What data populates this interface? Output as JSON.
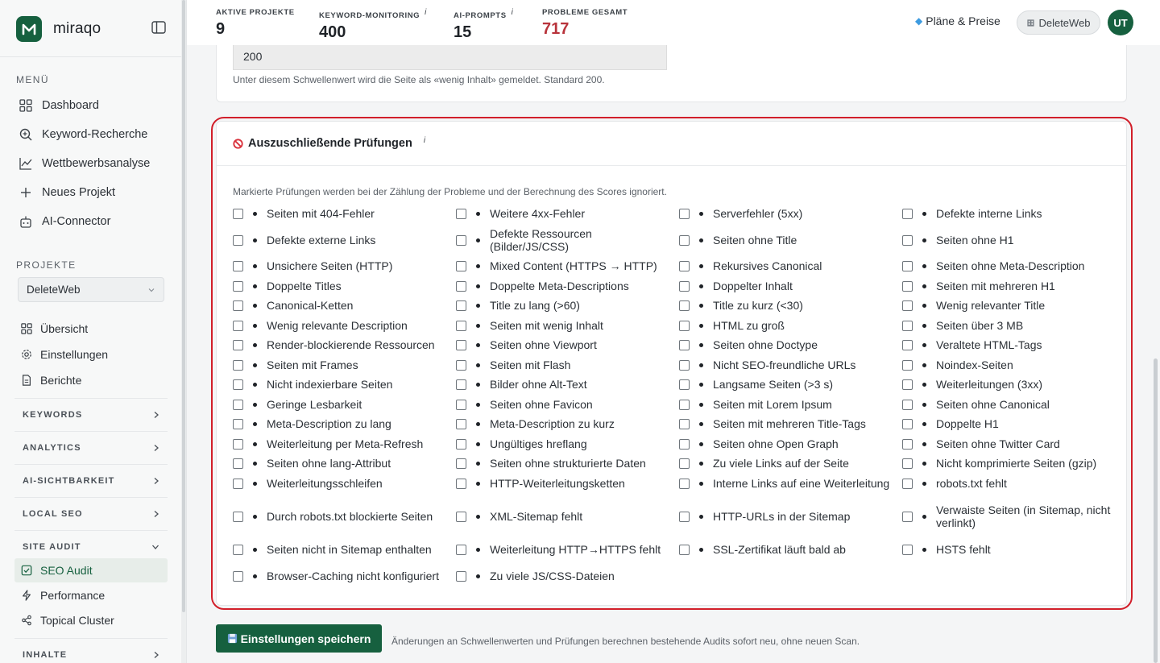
{
  "app": {
    "name": "miraqo"
  },
  "sidebar": {
    "menu_heading": "MENÜ",
    "menu": [
      {
        "label": "Dashboard",
        "icon": "grid-icon"
      },
      {
        "label": "Keyword-Recherche",
        "icon": "search-icon"
      },
      {
        "label": "Wettbewerbsanalyse",
        "icon": "chart-line-icon"
      },
      {
        "label": "Neues Projekt",
        "icon": "plus-icon"
      },
      {
        "label": "AI-Connector",
        "icon": "robot-icon"
      }
    ],
    "projects_heading": "PROJEKTE",
    "project_selected": "DeleteWeb",
    "project_items": [
      {
        "label": "Übersicht",
        "icon": "grid-icon"
      },
      {
        "label": "Einstellungen",
        "icon": "gear-icon"
      },
      {
        "label": "Berichte",
        "icon": "file-icon"
      }
    ],
    "groups": [
      {
        "label": "KEYWORDS",
        "state": "collapsed"
      },
      {
        "label": "ANALYTICS",
        "state": "collapsed"
      },
      {
        "label": "AI-SICHTBARKEIT",
        "state": "collapsed"
      },
      {
        "label": "LOCAL SEO",
        "state": "collapsed"
      },
      {
        "label": "SITE AUDIT",
        "state": "expanded"
      },
      {
        "label": "INHALTE",
        "state": "collapsed"
      }
    ],
    "site_audit_items": [
      {
        "label": "SEO Audit",
        "icon": "checkbox-icon",
        "active": true
      },
      {
        "label": "Performance",
        "icon": "bolt-icon",
        "active": false
      },
      {
        "label": "Topical Cluster",
        "icon": "share-icon",
        "active": false
      }
    ]
  },
  "topbar": {
    "stats": [
      {
        "label": "AKTIVE PROJEKTE",
        "value": "9",
        "info": ""
      },
      {
        "label": "KEYWORD-MONITORING",
        "value": "400",
        "info": "i"
      },
      {
        "label": "AI-PROMPTS",
        "value": "15",
        "info": "i"
      },
      {
        "label": "PROBLEME GESAMT",
        "value": "717",
        "info": "",
        "color": "#b8333b"
      }
    ],
    "plans_label": "Pläne & Preise",
    "workspace_label": "DeleteWeb",
    "avatar_initials": "UT"
  },
  "threshold": {
    "value": "200",
    "hint": "Unter diesem Schwellenwert wird die Seite als «wenig Inhalt» gemeldet. Standard 200."
  },
  "exclusions": {
    "title": "Auszuschließende Prüfungen",
    "info": "i",
    "description": "Markierte Prüfungen werden bei der Zählung der Probleme und der Berechnung des Scores ignoriert.",
    "checks": [
      "Seiten mit 404-Fehler",
      "Weitere 4xx-Fehler",
      "Serverfehler (5xx)",
      "Defekte interne Links",
      "Defekte externe Links",
      "Defekte Ressourcen (Bilder/JS/CSS)",
      "Seiten ohne Title",
      "Seiten ohne H1",
      "Unsichere Seiten (HTTP)",
      "Mixed Content (HTTPS → HTTP)",
      "Rekursives Canonical",
      "Seiten ohne Meta-Description",
      "Doppelte Titles",
      "Doppelte Meta-Descriptions",
      "Doppelter Inhalt",
      "Seiten mit mehreren H1",
      "Canonical-Ketten",
      "Title zu lang (>60)",
      "Title zu kurz (<30)",
      "Wenig relevanter Title",
      "Wenig relevante Description",
      "Seiten mit wenig Inhalt",
      "HTML zu groß",
      "Seiten über 3 MB",
      "Render-blockierende Ressourcen",
      "Seiten ohne Viewport",
      "Seiten ohne Doctype",
      "Veraltete HTML-Tags",
      "Seiten mit Frames",
      "Seiten mit Flash",
      "Nicht SEO-freundliche URLs",
      "Noindex-Seiten",
      "Nicht indexierbare Seiten",
      "Bilder ohne Alt-Text",
      "Langsame Seiten (>3 s)",
      "Weiterleitungen (3xx)",
      "Geringe Lesbarkeit",
      "Seiten ohne Favicon",
      "Seiten mit Lorem Ipsum",
      "Seiten ohne Canonical",
      "Meta-Description zu lang",
      "Meta-Description zu kurz",
      "Seiten mit mehreren Title-Tags",
      "Doppelte H1",
      "Weiterleitung per Meta-Refresh",
      "Ungültiges hreflang",
      "Seiten ohne Open Graph",
      "Seiten ohne Twitter Card",
      "Seiten ohne lang-Attribut",
      "Seiten ohne strukturierte Daten",
      "Zu viele Links auf der Seite",
      "Nicht komprimierte Seiten (gzip)",
      "Weiterleitungsschleifen",
      "HTTP-Weiterleitungsketten",
      "Interne Links auf eine Weiterleitung",
      "robots.txt fehlt",
      "Durch robots.txt blockierte Seiten",
      "XML-Sitemap fehlt",
      "HTTP-URLs in der Sitemap",
      "Verwaiste Seiten (in Sitemap, nicht verlinkt)",
      "Seiten nicht in Sitemap enthalten",
      "Weiterleitung HTTP→HTTPS fehlt",
      "SSL-Zertifikat läuft bald ab",
      "HSTS fehlt",
      "Browser-Caching nicht konfiguriert",
      "Zu viele JS/CSS-Dateien"
    ]
  },
  "footer": {
    "save_label": "Einstellungen speichern",
    "save_hint": "Änderungen an Schwellenwerten und Prüfungen berechnen bestehende Audits sofort neu, ohne neuen Scan."
  },
  "colors": {
    "brand": "#16603f",
    "alert": "#d21f2a",
    "problems": "#b8333b"
  }
}
